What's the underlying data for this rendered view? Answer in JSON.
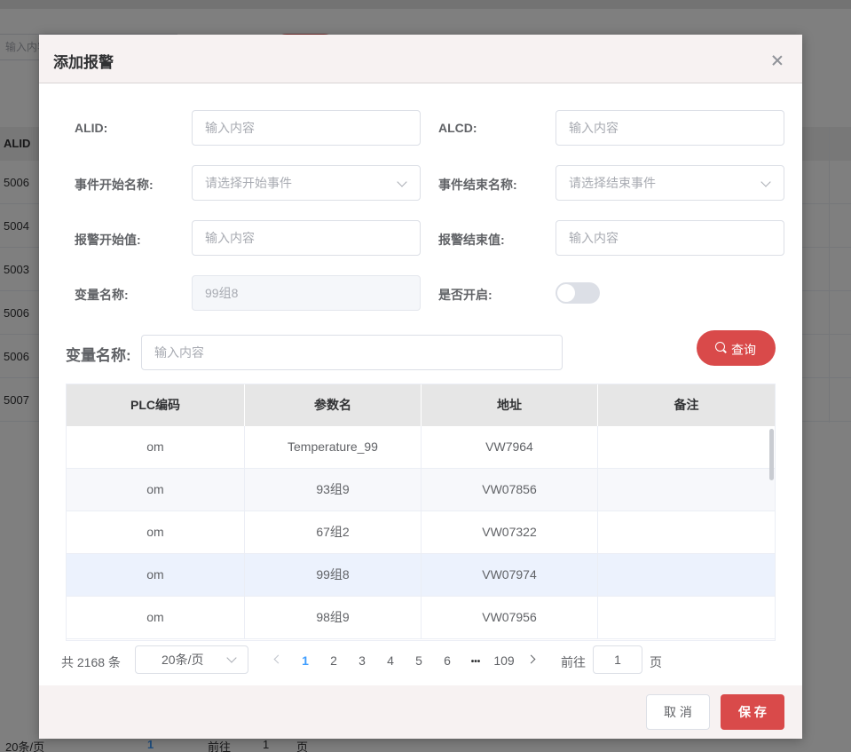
{
  "background": {
    "search_placeholder": "输入内容",
    "table_header": "ALID",
    "rows": [
      "5006",
      "5004",
      "5003",
      "5006",
      "5006",
      "5007"
    ],
    "pager": {
      "size": "20条/页",
      "current": "1",
      "goto": "前往",
      "input": "1",
      "page_suffix": "页"
    }
  },
  "dialog": {
    "title": "添加报警",
    "form": {
      "alid_label": "ALID:",
      "alid_placeholder": "输入内容",
      "alcd_label": "ALCD:",
      "alcd_placeholder": "输入内容",
      "start_event_label": "事件开始名称:",
      "start_event_placeholder": "请选择开始事件",
      "end_event_label": "事件结束名称:",
      "end_event_placeholder": "请选择结束事件",
      "alarm_start_label": "报警开始值:",
      "alarm_start_placeholder": "输入内容",
      "alarm_end_label": "报警结束值:",
      "alarm_end_placeholder": "输入内容",
      "variable_label": "变量名称:",
      "variable_value": "99组8",
      "enabled_label": "是否开启:",
      "enabled": false
    },
    "search": {
      "label": "变量名称:",
      "placeholder": "输入内容",
      "button": "查询"
    },
    "table": {
      "columns": [
        "PLC编码",
        "参数名",
        "地址",
        "备注"
      ],
      "rows": [
        {
          "plc": "om",
          "param": "Temperature_99",
          "addr": "VW7964",
          "note": ""
        },
        {
          "plc": "om",
          "param": "93组9",
          "addr": "VW07856",
          "note": ""
        },
        {
          "plc": "om",
          "param": "67组2",
          "addr": "VW07322",
          "note": ""
        },
        {
          "plc": "om",
          "param": "99组8",
          "addr": "VW07974",
          "note": ""
        },
        {
          "plc": "om",
          "param": "98组9",
          "addr": "VW07956",
          "note": ""
        }
      ]
    },
    "pagination": {
      "total": "共 2168 条",
      "page_size": "20条/页",
      "pages": [
        "1",
        "2",
        "3",
        "4",
        "5",
        "6"
      ],
      "ellipsis": "•••",
      "last": "109",
      "current": "1",
      "goto_label": "前往",
      "goto_value": "1",
      "page_suffix": "页"
    },
    "footer": {
      "cancel": "取 消",
      "save": "保 存"
    },
    "colors": {
      "accent": "#d94a4a",
      "active_page": "#409eff",
      "highlight_row": "#ecf2fd"
    }
  }
}
